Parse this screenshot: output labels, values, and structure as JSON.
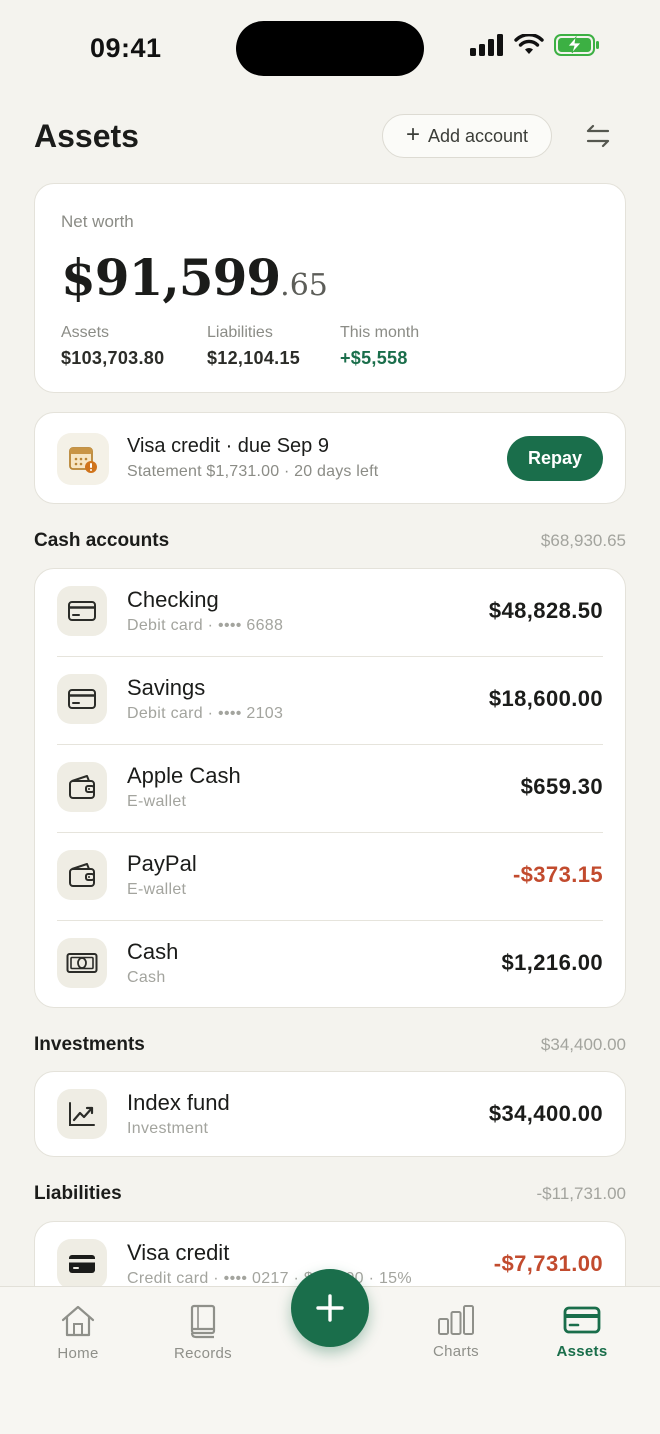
{
  "status_bar": {
    "time": "09:41"
  },
  "header": {
    "title": "Assets",
    "add_account_label": "Add account"
  },
  "net_worth": {
    "label": "Net worth",
    "amount_main": "$91,599",
    "amount_cents": ".65",
    "stats": [
      {
        "label": "Assets",
        "value": "$103,703.80"
      },
      {
        "label": "Liabilities",
        "value": "$12,104.15"
      },
      {
        "label": "This month",
        "value": "+$5,558"
      }
    ]
  },
  "due_reminder": {
    "title": "Visa credit · due Sep 9",
    "subtitle": "Statement $1,731.00 · 20 days left",
    "button_label": "Repay"
  },
  "sections": {
    "cash": {
      "title": "Cash accounts",
      "total": "$68,930.65",
      "accounts": [
        {
          "name": "Checking",
          "sub": "Debit card · •••• 6688",
          "amount": "$48,828.50",
          "icon": "card-icon"
        },
        {
          "name": "Savings",
          "sub": "Debit card · •••• 2103",
          "amount": "$18,600.00",
          "icon": "card-icon"
        },
        {
          "name": "Apple Cash",
          "sub": "E-wallet",
          "amount": "$659.30",
          "icon": "wallet-icon"
        },
        {
          "name": "PayPal",
          "sub": "E-wallet",
          "amount": "-$373.15",
          "icon": "wallet-icon"
        },
        {
          "name": "Cash",
          "sub": "Cash",
          "amount": "$1,216.00",
          "icon": "banknote-icon"
        }
      ]
    },
    "investments": {
      "title": "Investments",
      "total": "$34,400.00",
      "accounts": [
        {
          "name": "Index fund",
          "sub": "Investment",
          "amount": "$34,400.00",
          "icon": "trend-up-icon"
        }
      ]
    },
    "liabilities": {
      "title": "Liabilities",
      "total": "-$11,731.00",
      "accounts": [
        {
          "name": "Visa credit",
          "sub": "Credit card · •••• 0217 · $20,000 · 15%",
          "amount": "-$7,731.00",
          "icon": "credit-card-icon"
        }
      ]
    }
  },
  "tab_bar": {
    "tabs": [
      {
        "label": "Home",
        "icon": "home-icon"
      },
      {
        "label": "Records",
        "icon": "book-icon"
      },
      {
        "label": "Charts",
        "icon": "bar-chart-icon"
      },
      {
        "label": "Assets",
        "icon": "card-icon",
        "active": true
      }
    ],
    "fab_icon": "plus-icon"
  },
  "colors": {
    "accent": "#1a6e4b",
    "negative": "#c24b2e",
    "background": "#f4f3ee",
    "card": "#ffffff"
  }
}
